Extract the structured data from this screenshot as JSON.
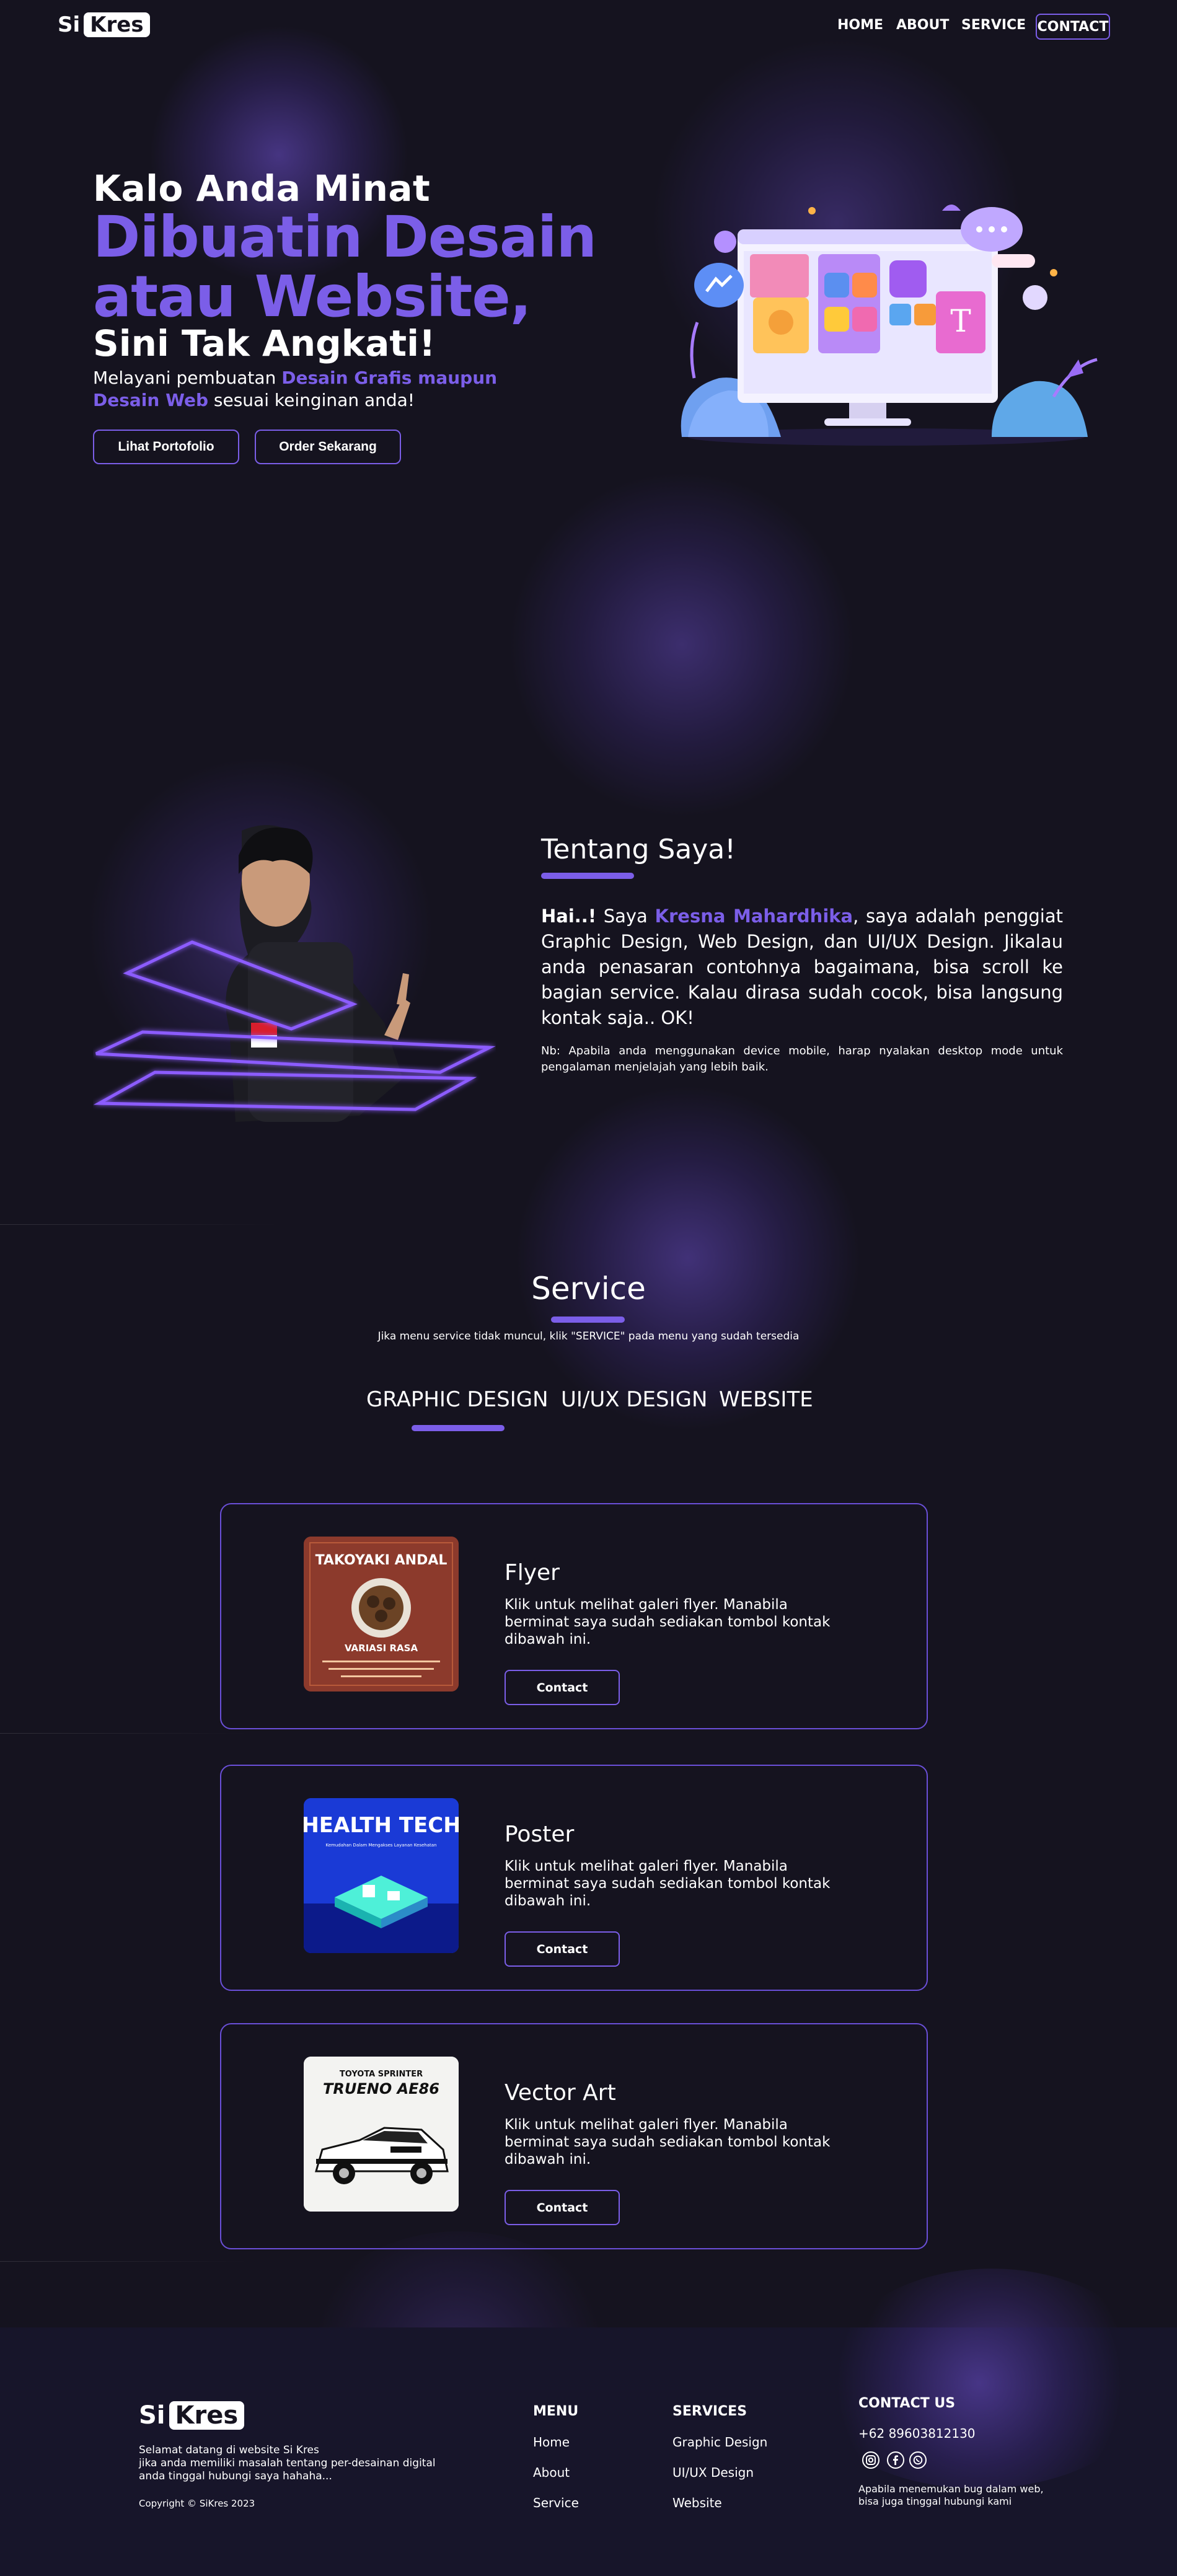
{
  "header": {
    "logo_si": "Si",
    "logo_kres": "Kres",
    "nav": [
      "HOME",
      "ABOUT",
      "SERVICE"
    ],
    "contact_label": "CONTACT"
  },
  "hero": {
    "line1": "Kalo Anda Minat",
    "line2": "Dibuatin Desain atau Website,",
    "line3": "Sini Tak Angkati!",
    "desc_prefix": "Melayani pembuatan ",
    "desc_highlight": "Desain Grafis maupun Desain Web",
    "desc_suffix": " sesuai keinginan anda!",
    "btn_portfolio": "Lihat Portofolio",
    "btn_order": "Order Sekarang"
  },
  "about": {
    "title": "Tentang Saya!",
    "greeting": "Hai..!",
    "text_pre": " Saya ",
    "name": "Kresna Mahardhika",
    "text_post": ", saya adalah penggiat Graphic Design, Web Design, dan UI/UX Design. Jikalau anda penasaran contohnya bagaimana, bisa scroll ke bagian service. Kalau dirasa sudah cocok, bisa langsung kontak saja.. OK!",
    "note": "Nb: Apabila anda menggunakan device mobile, harap nyalakan desktop mode untuk pengalaman menjelajah yang lebih baik."
  },
  "service": {
    "title": "Service",
    "subtitle": "Jika menu service tidak muncul, klik \"SERVICE\" pada menu yang sudah tersedia",
    "tabs": [
      "GRAPHIC DESIGN",
      "UI/UX DESIGN",
      "WEBSITE"
    ],
    "active_tab": "GRAPHIC DESIGN",
    "cards": [
      {
        "title": "Flyer",
        "desc": "Klik untuk melihat galeri flyer. Manabila berminat saya sudah sediakan tombol kontak dibawah ini.",
        "button": "Contact",
        "thumb_title": "TAKOYAKI ANDAL",
        "thumb_sub": "VARIASI RASA"
      },
      {
        "title": "Poster",
        "desc": "Klik untuk melihat galeri flyer. Manabila berminat saya sudah sediakan tombol kontak dibawah ini.",
        "button": "Contact",
        "thumb_title": "HEALTH TECH",
        "thumb_sub": "Kemudahan Dalam Mengakses Layanan Kesehatan"
      },
      {
        "title": "Vector Art",
        "desc": "Klik untuk melihat galeri flyer. Manabila berminat saya sudah sediakan tombol kontak dibawah ini.",
        "button": "Contact",
        "thumb_title": "TRUENO AE86",
        "thumb_sub": "TOYOTA SPRINTER"
      }
    ]
  },
  "footer": {
    "logo_si": "Si",
    "logo_kres": "Kres",
    "welcome": "Selamat datang di website Si Kres",
    "welcome2": "jika anda memiliki masalah tentang per-desainan digital anda tinggal hubungi saya hahaha...",
    "copyright": "Copyright © SiKres 2023",
    "menu_title": "MENU",
    "menu": [
      "Home",
      "About",
      "Service"
    ],
    "services_title": "SERVICES",
    "services": [
      "Graphic Design",
      "UI/UX Design",
      "Website"
    ],
    "contact_title": "CONTACT US",
    "phone": "+62 89603812130",
    "bug_note": "Apabila menemukan bug dalam web, bisa juga tinggal hubungi kami",
    "socials": [
      "instagram-icon",
      "facebook-icon",
      "whatsapp-icon"
    ]
  },
  "colors": {
    "accent": "#7b5ee8",
    "background": "#15131f"
  }
}
